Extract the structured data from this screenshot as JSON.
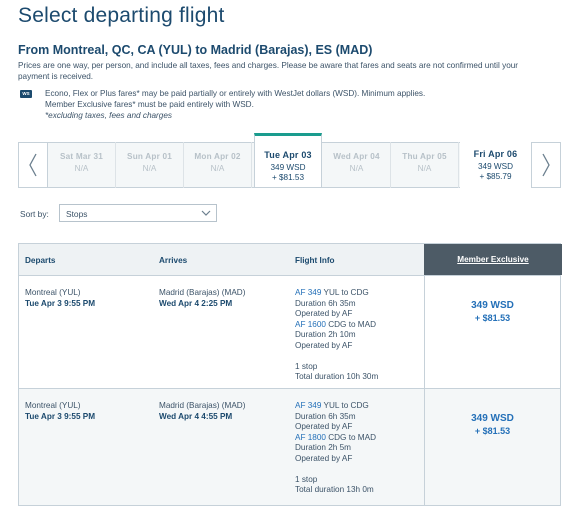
{
  "header": {
    "title": "Select departing flight",
    "route": "From Montreal, QC, CA (YUL) to Madrid (Barajas), ES (MAD)",
    "price_note": "Prices are one way, per person, and include all taxes, fees and charges.  Please be aware that fares and seats are not confirmed until your payment is received."
  },
  "westjet_note": {
    "badge": "WS",
    "line1": "Econo, Flex or Plus fares* may be paid partially or entirely with WestJet dollars (WSD). Minimum applies.",
    "line2": "Member Exclusive fares* must be paid entirely with WSD.",
    "line3": "*excluding taxes, fees and charges"
  },
  "date_strip": {
    "days": [
      {
        "date": "Sat Mar 31",
        "price": "N/A",
        "extra": ""
      },
      {
        "date": "Sun Apr 01",
        "price": "N/A",
        "extra": ""
      },
      {
        "date": "Mon Apr 02",
        "price": "N/A",
        "extra": ""
      },
      {
        "date": "Tue Apr 03",
        "price": "349 WSD",
        "extra": "+ $81.53"
      },
      {
        "date": "Wed Apr 04",
        "price": "N/A",
        "extra": ""
      },
      {
        "date": "Thu Apr 05",
        "price": "N/A",
        "extra": ""
      },
      {
        "date": "Fri Apr 06",
        "price": "349 WSD",
        "extra": "+ $85.79"
      }
    ],
    "selected_index": 3
  },
  "sort": {
    "label": "Sort by:",
    "value": "Stops"
  },
  "table": {
    "headers": {
      "departs": "Departs",
      "arrives": "Arrives",
      "info": "Flight Info",
      "member": "Member Exclusive"
    },
    "rows": [
      {
        "dep_city": "Montreal (YUL)",
        "dep_time": "Tue Apr 3 9:55 PM",
        "arr_city": "Madrid (Barajas) (MAD)",
        "arr_time": "Wed Apr 4 2:25 PM",
        "seg1_flight": "AF 349",
        "seg1_route": " YUL to CDG",
        "seg1_duration": "Duration 6h 35m",
        "seg1_op": "Operated by AF",
        "seg2_flight": "AF 1600",
        "seg2_route": " CDG to MAD",
        "seg2_duration": "Duration 2h 10m",
        "seg2_op": "Operated by AF",
        "stops": "1 stop",
        "total": "Total duration 10h 30m",
        "price_wsd": "349 WSD",
        "price_cash": "+ $81.53"
      },
      {
        "dep_city": "Montreal (YUL)",
        "dep_time": "Tue Apr 3 9:55 PM",
        "arr_city": "Madrid (Barajas) (MAD)",
        "arr_time": "Wed Apr 4 4:55 PM",
        "seg1_flight": "AF 349",
        "seg1_route": " YUL to CDG",
        "seg1_duration": "Duration 6h 35m",
        "seg1_op": "Operated by AF",
        "seg2_flight": "AF 1800",
        "seg2_route": " CDG to MAD",
        "seg2_duration": "Duration 2h 5m",
        "seg2_op": "Operated by AF",
        "stops": "1 stop",
        "total": "Total duration 13h 0m",
        "price_wsd": "349 WSD",
        "price_cash": "+ $81.53"
      }
    ]
  },
  "colors": {
    "accent": "#1a9c8e",
    "title": "#1c4a6e",
    "link": "#2470b8",
    "member_header": "#4d5b66"
  },
  "icons": {
    "prev": "chevron-left-icon",
    "next": "chevron-right-icon",
    "dropdown": "chevron-down-icon"
  }
}
